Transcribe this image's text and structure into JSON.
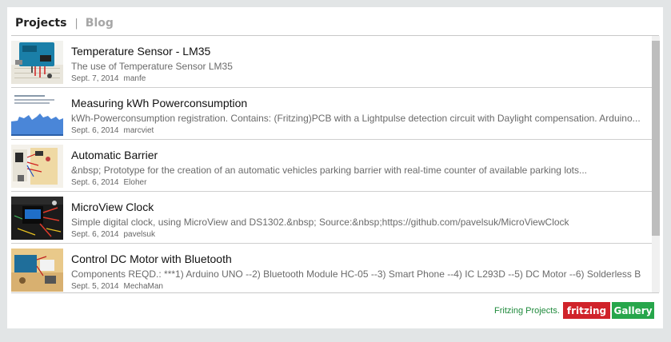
{
  "tabs": {
    "active": "Projects",
    "separator": "|",
    "inactive": "Blog"
  },
  "projects": [
    {
      "title": "Temperature Sensor - LM35",
      "description": "The use of Temperature Sensor LM35",
      "date": "Sept. 7, 2014",
      "author": "manfe",
      "thumbnail_icon": "arduino-breadboard-thumbnail"
    },
    {
      "title": "Measuring kWh Powerconsumption",
      "description": "kWh-Powerconsumption registration. Contains: (Fritzing)PCB with a Lightpulse detection circuit with Daylight compensation. Arduino...",
      "date": "Sept. 6, 2014",
      "author": "marcviet",
      "thumbnail_icon": "power-graph-thumbnail"
    },
    {
      "title": "Automatic Barrier",
      "description": "&nbsp;  Prototype for the creation of an automatic vehicles parking barrier with real-time counter of available parking lots...",
      "date": "Sept. 6, 2014",
      "author": "Eloher",
      "thumbnail_icon": "barrier-circuit-thumbnail"
    },
    {
      "title": "MicroView Clock",
      "description": "Simple digital clock, using MicroView and DS1302.&nbsp;  Source:&nbsp;https://github.com/pavelsuk/MicroViewClock",
      "date": "Sept. 6, 2014",
      "author": "pavelsuk",
      "thumbnail_icon": "microview-clock-thumbnail"
    },
    {
      "title": "Control DC Motor with Bluetooth",
      "description": "Components REQD.: ***1) Arduino UNO --2) Bluetooth Module HC-05 --3) Smart Phone --4) IC L293D --5) DC Motor --6) Solderless B",
      "date": "Sept. 5, 2014",
      "author": "MechaMan",
      "thumbnail_icon": "dc-motor-thumbnail"
    }
  ],
  "footer": {
    "link_text": "Fritzing Projects.",
    "badge_red": "fritzing",
    "badge_green": "Gallery"
  },
  "colors": {
    "badge_red": "#d0232a",
    "badge_green": "#27a64b",
    "footer_link": "#1f8a3c"
  }
}
